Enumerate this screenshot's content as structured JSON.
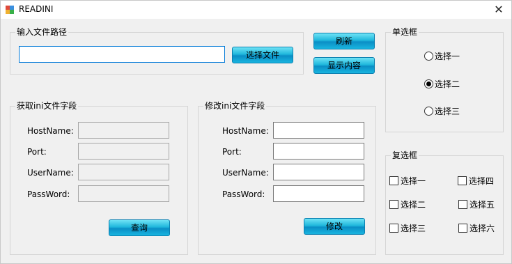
{
  "window": {
    "title": "READINI"
  },
  "file_group": {
    "legend": "输入文件路径",
    "path_value": "",
    "choose_label": "选择文件"
  },
  "actions": {
    "refresh_label": "刷新",
    "show_label": "显示内容"
  },
  "read_group": {
    "legend": "获取ini文件字段",
    "fields": [
      {
        "label": "HostName:",
        "value": ""
      },
      {
        "label": "Port:",
        "value": ""
      },
      {
        "label": "UserName:",
        "value": ""
      },
      {
        "label": "PassWord:",
        "value": ""
      }
    ],
    "query_label": "查询"
  },
  "edit_group": {
    "legend": "修改ini文件字段",
    "fields": [
      {
        "label": "HostName:",
        "value": ""
      },
      {
        "label": "Port:",
        "value": ""
      },
      {
        "label": "UserName:",
        "value": ""
      },
      {
        "label": "PassWord:",
        "value": ""
      }
    ],
    "modify_label": "修改"
  },
  "radio_group": {
    "legend": "单选框",
    "options": [
      {
        "label": "选择一",
        "selected": false
      },
      {
        "label": "选择二",
        "selected": true
      },
      {
        "label": "选择三",
        "selected": false
      }
    ]
  },
  "check_group": {
    "legend": "复选框",
    "options": [
      {
        "label": "选择一",
        "checked": false
      },
      {
        "label": "选择四",
        "checked": false
      },
      {
        "label": "选择二",
        "checked": false
      },
      {
        "label": "选择五",
        "checked": false
      },
      {
        "label": "选择三",
        "checked": false
      },
      {
        "label": "选择六",
        "checked": false
      }
    ]
  }
}
